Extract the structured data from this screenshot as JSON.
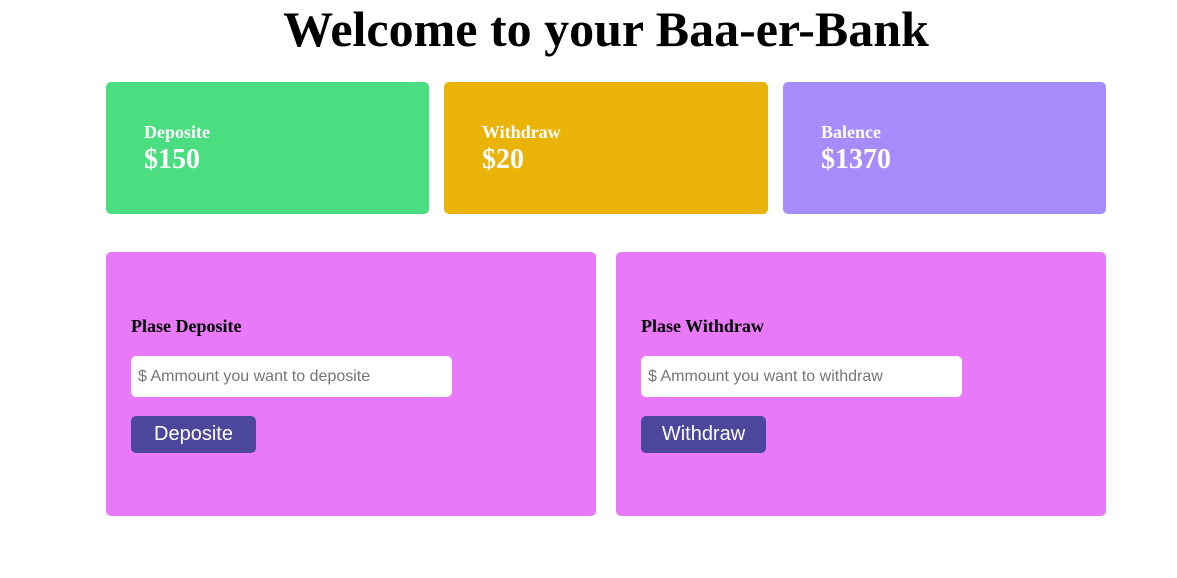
{
  "page": {
    "title": "Welcome to your Baa-er-Bank"
  },
  "stats": [
    {
      "label": "Deposite",
      "value": "$150",
      "color": "#4ade80"
    },
    {
      "label": "Withdraw",
      "value": "$20",
      "color": "#eab308"
    },
    {
      "label": "Balence",
      "value": "$1370",
      "color": "#a78bfa"
    }
  ],
  "deposit_form": {
    "heading": "Plase Deposite",
    "input_value": "",
    "placeholder": "$ Ammount you want to deposite",
    "button_label": "Deposite"
  },
  "withdraw_form": {
    "heading": "Plase Withdraw",
    "input_value": "",
    "placeholder": "$ Ammount you want to withdraw",
    "button_label": "Withdraw"
  },
  "colors": {
    "form_card_bg": "#e879f9",
    "button_bg": "#4c479c",
    "stat_text": "#ffffff"
  }
}
